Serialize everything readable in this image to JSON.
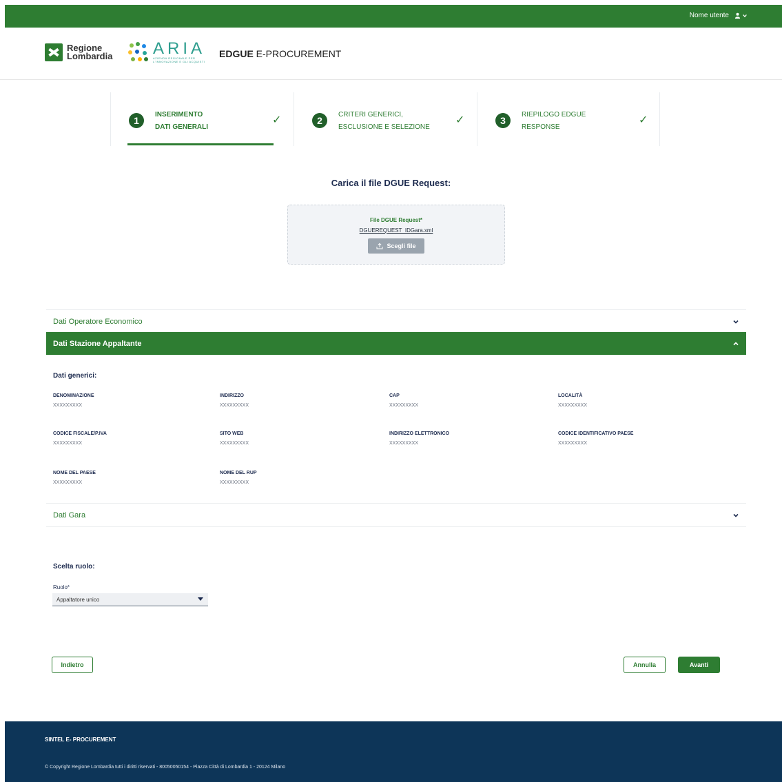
{
  "topbar": {
    "user_label": "Nome utente",
    "user_icon": "person-icon",
    "chevron_icon": "chevron-down-icon",
    "bg": "#2e7d32"
  },
  "header": {
    "logo_rl_line1": "Regione",
    "logo_rl_line2": "Lombardia",
    "logo_aria_word": "ARIA",
    "logo_aria_sub1": "AZIENDA REGIONALE PER",
    "logo_aria_sub2": "L'INNOVAZIONE E GLI ACQUISTI",
    "app_title_bold": "EDGUE",
    "app_title_rest": " E-PROCUREMENT"
  },
  "stepper": {
    "steps": [
      {
        "num": "1",
        "line1": "INSERIMENTO",
        "line2": "DATI GENERALI",
        "active": true,
        "done": true
      },
      {
        "num": "2",
        "line1": "CRITERI GENERICI,",
        "line2": "ESCLUSIONE E SELEZIONE",
        "active": false,
        "done": true
      },
      {
        "num": "3",
        "line1": "RIEPILOGO EDGUE",
        "line2": "RESPONSE",
        "active": false,
        "done": true
      }
    ],
    "check_glyph": "✓"
  },
  "upload": {
    "title": "Carica il file DGUE Request:",
    "label": "File DGUE Request*",
    "file_name": "DGUEREQUEST_IDGara.xml",
    "button_label": "Scegli file",
    "button_icon": "upload-icon"
  },
  "accordions": {
    "operatore": {
      "label": "Dati Operatore Economico",
      "state": "collapsed"
    },
    "stazione": {
      "label": "Dati Stazione Appaltante",
      "state": "expanded"
    },
    "gara": {
      "label": "Dati Gara",
      "state": "collapsed"
    }
  },
  "dati_generici": {
    "title": "Dati generici:",
    "fields": [
      {
        "key": "DENOMINAZIONE",
        "value": "XXXXXXXXX"
      },
      {
        "key": "INDIRIZZO",
        "value": "XXXXXXXXX"
      },
      {
        "key": "CAP",
        "value": "XXXXXXXXX"
      },
      {
        "key": "LOCALITÀ",
        "value": "XXXXXXXXX"
      },
      {
        "key": "CODICE FISCALE/P.IVA",
        "value": "XXXXXXXXX"
      },
      {
        "key": "SITO WEB",
        "value": "XXXXXXXXX"
      },
      {
        "key": "INDIRIZZO ELETTRONICO",
        "value": "XXXXXXXXX"
      },
      {
        "key": "CODICE IDENTIFICATIVO PAESE",
        "value": "XXXXXXXXX"
      },
      {
        "key": "NOME DEL PAESE",
        "value": "XXXXXXXXX"
      },
      {
        "key": "NOME DEL RUP",
        "value": "XXXXXXXXX"
      }
    ]
  },
  "ruolo": {
    "title": "Scelta ruolo:",
    "label": "Ruolo*",
    "selected": "Appaltatore unico"
  },
  "actions": {
    "back": "Indietro",
    "cancel": "Annulla",
    "next": "Avanti"
  },
  "footer": {
    "title": "SINTEL E- PROCUREMENT",
    "copyright": "© Copyright Regione Lombardia tutti i diritti riservati - 80050050154 - Piazza Città di Lombardia 1 - 20124 Milano",
    "bg": "#0d3558"
  }
}
